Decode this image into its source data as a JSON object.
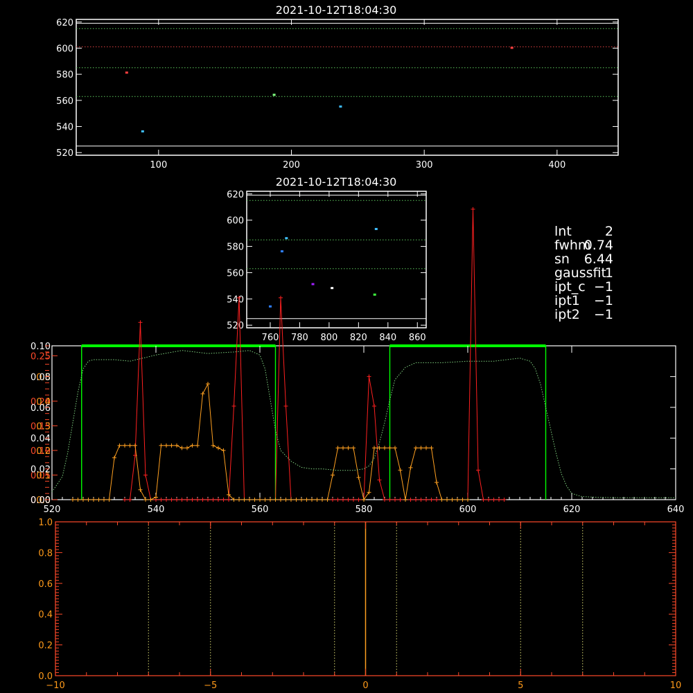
{
  "colors": {
    "background": "#000000",
    "axes": "#ffffff",
    "red": "#ff2020",
    "orange": "#ffa020",
    "green": "#00ff00",
    "green_dotted": "#7fd07f",
    "red_axis": "#ff4a2a",
    "orange_axis": "#ff9a1a",
    "blue": "#3080ff",
    "cyan": "#40c0ff"
  },
  "info": {
    "lines": [
      {
        "key": "lnt",
        "value": "2"
      },
      {
        "key": "fwhm",
        "value": "0.74"
      },
      {
        "key": "sn",
        "value": "6.44"
      },
      {
        "key": "gaussfit",
        "value": "1"
      },
      {
        "key": "ipt_c",
        "value": "−1"
      },
      {
        "key": "ipt1",
        "value": "−1"
      },
      {
        "key": "ipt2",
        "value": "−1"
      }
    ]
  },
  "chart_data": [
    {
      "type": "scatter",
      "title": "2021-10-12T18:04:30",
      "xlim": [
        38,
        446
      ],
      "ylim": [
        518,
        622
      ],
      "xticks": [
        100,
        200,
        300,
        400
      ],
      "yticks": [
        520,
        540,
        560,
        580,
        600,
        620
      ],
      "hlines": [
        {
          "y": 525,
          "color": "#ffffff",
          "style": "solid"
        },
        {
          "y": 563,
          "color": "#5ec85e",
          "style": "dotted"
        },
        {
          "y": 585,
          "color": "#5ec85e",
          "style": "dotted"
        },
        {
          "y": 601,
          "color": "#e04040",
          "style": "dotted"
        },
        {
          "y": 615,
          "color": "#5ec85e",
          "style": "dotted"
        },
        {
          "y": 619,
          "color": "#ffffff",
          "style": "solid"
        }
      ],
      "points": [
        {
          "x": 76,
          "y": 581,
          "color": "#ff4040"
        },
        {
          "x": 88,
          "y": 536,
          "color": "#40c0ff"
        },
        {
          "x": 187,
          "y": 564,
          "color": "#80ff80"
        },
        {
          "x": 237,
          "y": 555,
          "color": "#40c0ff"
        },
        {
          "x": 366,
          "y": 600,
          "color": "#ff4040"
        }
      ]
    },
    {
      "type": "scatter",
      "title": "2021-10-12T18:04:30",
      "xlim": [
        744,
        866
      ],
      "ylim": [
        518,
        622
      ],
      "xticks": [
        760,
        780,
        800,
        820,
        840,
        860
      ],
      "yticks": [
        520,
        540,
        560,
        580,
        600,
        620
      ],
      "hlines": [
        {
          "y": 525,
          "color": "#ffffff",
          "style": "solid"
        },
        {
          "y": 563,
          "color": "#5ec85e",
          "style": "dotted"
        },
        {
          "y": 585,
          "color": "#5ec85e",
          "style": "dotted"
        },
        {
          "y": 615,
          "color": "#5ec85e",
          "style": "dotted"
        },
        {
          "y": 619,
          "color": "#ffffff",
          "style": "solid"
        }
      ],
      "points": [
        {
          "x": 760,
          "y": 534,
          "color": "#3080ff"
        },
        {
          "x": 768,
          "y": 576,
          "color": "#3080ff"
        },
        {
          "x": 771,
          "y": 586,
          "color": "#40c0ff"
        },
        {
          "x": 789,
          "y": 551,
          "color": "#a020ff"
        },
        {
          "x": 802,
          "y": 548,
          "color": "#ffffff"
        },
        {
          "x": 831,
          "y": 543,
          "color": "#40ff40"
        },
        {
          "x": 832,
          "y": 593,
          "color": "#40c0ff"
        }
      ]
    },
    {
      "type": "line",
      "xlim": [
        520,
        640
      ],
      "xticks": [
        520,
        540,
        560,
        580,
        600,
        620,
        640
      ],
      "left_axis_ticks": {
        "red": [
          "0.00",
          "0.05",
          "0.10",
          "0.15",
          "0.20",
          "0.25"
        ],
        "orange": [
          "0.0",
          "0.1",
          "0.2",
          "0.3",
          "0.4",
          "0.5"
        ],
        "white": [
          "0.00",
          "0.02",
          "0.04",
          "0.06",
          "0.08",
          "0.10"
        ]
      },
      "green_bands": [
        [
          525.7,
          563.0
        ],
        [
          585.0,
          615.0
        ]
      ],
      "series": [
        {
          "color": "#ff2020",
          "markers": true,
          "x": [
            534,
            535,
            536,
            537,
            538,
            539,
            540,
            541,
            542,
            543,
            544,
            545,
            546,
            547,
            548,
            549,
            550,
            551,
            552,
            553,
            554,
            555,
            556,
            557,
            558,
            559,
            560,
            561,
            562,
            563,
            564,
            565,
            566,
            567,
            568,
            569,
            570,
            571,
            572,
            573,
            574,
            575,
            576,
            577,
            578,
            579,
            580,
            581,
            582,
            583,
            584,
            585,
            586,
            587,
            588,
            589,
            590,
            591,
            592,
            593,
            594,
            595,
            596,
            597,
            598,
            599,
            600,
            601,
            602,
            603,
            604,
            605,
            606,
            607
          ],
          "y": [
            0,
            0,
            0.09,
            0.36,
            0.05,
            0,
            0,
            0,
            0,
            0,
            0,
            0,
            0,
            0,
            0,
            0,
            0,
            0,
            0,
            0,
            0,
            0.19,
            0.41,
            0,
            0,
            0,
            0,
            0,
            0,
            0,
            0.41,
            0.19,
            0,
            0,
            0,
            0,
            0,
            0,
            0,
            0,
            0,
            0,
            0,
            0,
            0,
            0,
            0,
            0.25,
            0.19,
            0.04,
            0,
            0,
            0,
            0,
            0,
            0,
            0,
            0,
            0,
            0,
            0,
            0,
            0,
            0,
            0,
            0,
            0,
            0.59,
            0.06,
            0,
            0,
            0,
            0,
            0
          ]
        },
        {
          "color": "#ffa020",
          "markers": true,
          "x": [
            524,
            525,
            526,
            527,
            528,
            529,
            530,
            531,
            532,
            533,
            534,
            535,
            536,
            537,
            538,
            539,
            540,
            541,
            542,
            543,
            544,
            545,
            546,
            547,
            548,
            549,
            550,
            551,
            552,
            553,
            554,
            555,
            556,
            557,
            558,
            559,
            560,
            561,
            562,
            563,
            564,
            565,
            566,
            567,
            568,
            569,
            570,
            571,
            572,
            573,
            574,
            575,
            576,
            577,
            578,
            579,
            580,
            581,
            582,
            583,
            584,
            585,
            586,
            587,
            588,
            589,
            590,
            591,
            592,
            593,
            594,
            595,
            596,
            597,
            598,
            599,
            600
          ],
          "y": [
            0,
            0,
            0,
            0,
            0,
            0,
            0,
            0,
            0.17,
            0.22,
            0.22,
            0.22,
            0.22,
            0.04,
            0,
            0,
            0.01,
            0.22,
            0.22,
            0.22,
            0.22,
            0.21,
            0.21,
            0.22,
            0.22,
            0.43,
            0.47,
            0.22,
            0.21,
            0.2,
            0.02,
            0,
            0,
            0,
            0,
            0,
            0,
            0,
            0,
            0,
            0,
            0,
            0,
            0,
            0,
            0,
            0,
            0,
            0,
            0,
            0.1,
            0.21,
            0.21,
            0.21,
            0.21,
            0.09,
            0,
            0.03,
            0.21,
            0.21,
            0.21,
            0.21,
            0.21,
            0.12,
            0,
            0.13,
            0.21,
            0.21,
            0.21,
            0.21,
            0.07,
            0,
            0,
            0,
            0,
            0,
            0
          ]
        },
        {
          "color": "#7fd07f",
          "style": "dotted",
          "x": [
            520,
            522,
            523,
            524,
            525,
            526,
            527,
            528,
            530,
            532,
            535,
            540,
            545,
            550,
            555,
            558,
            560,
            561,
            562,
            563,
            564,
            566,
            568,
            570,
            572,
            575,
            578,
            580,
            581,
            582,
            583,
            584,
            585,
            586,
            588,
            590,
            595,
            600,
            605,
            610,
            612,
            613,
            614,
            615,
            616,
            617,
            618,
            619,
            620,
            622,
            625,
            630,
            635,
            640
          ],
          "y": [
            0.005,
            0.015,
            0.03,
            0.05,
            0.07,
            0.085,
            0.09,
            0.091,
            0.091,
            0.091,
            0.09,
            0.094,
            0.097,
            0.095,
            0.096,
            0.097,
            0.094,
            0.085,
            0.065,
            0.045,
            0.032,
            0.025,
            0.021,
            0.02,
            0.02,
            0.019,
            0.019,
            0.02,
            0.022,
            0.027,
            0.037,
            0.05,
            0.065,
            0.078,
            0.086,
            0.089,
            0.089,
            0.09,
            0.09,
            0.092,
            0.09,
            0.085,
            0.075,
            0.06,
            0.045,
            0.03,
            0.017,
            0.009,
            0.004,
            0.002,
            0.0015,
            0.0012,
            0.0012,
            0.0012
          ]
        }
      ]
    },
    {
      "type": "line",
      "xlim": [
        -10,
        10
      ],
      "ylim": [
        0,
        1
      ],
      "xticks": [
        -10,
        -5,
        0,
        5,
        10
      ],
      "yticks": [
        "0.0",
        "0.2",
        "0.4",
        "0.6",
        "0.8",
        "1.0"
      ],
      "vlines": [
        {
          "x": -7,
          "color": "#d8d870",
          "style": "dotted"
        },
        {
          "x": -5,
          "color": "#d8d870",
          "style": "dotted"
        },
        {
          "x": -1,
          "color": "#d8d870",
          "style": "dotted"
        },
        {
          "x": 0,
          "color": "#ffa020",
          "style": "solid"
        },
        {
          "x": 1,
          "color": "#d8d870",
          "style": "dotted"
        },
        {
          "x": 5,
          "color": "#d8d870",
          "style": "dotted"
        },
        {
          "x": 7,
          "color": "#d8d870",
          "style": "dotted"
        }
      ]
    }
  ]
}
